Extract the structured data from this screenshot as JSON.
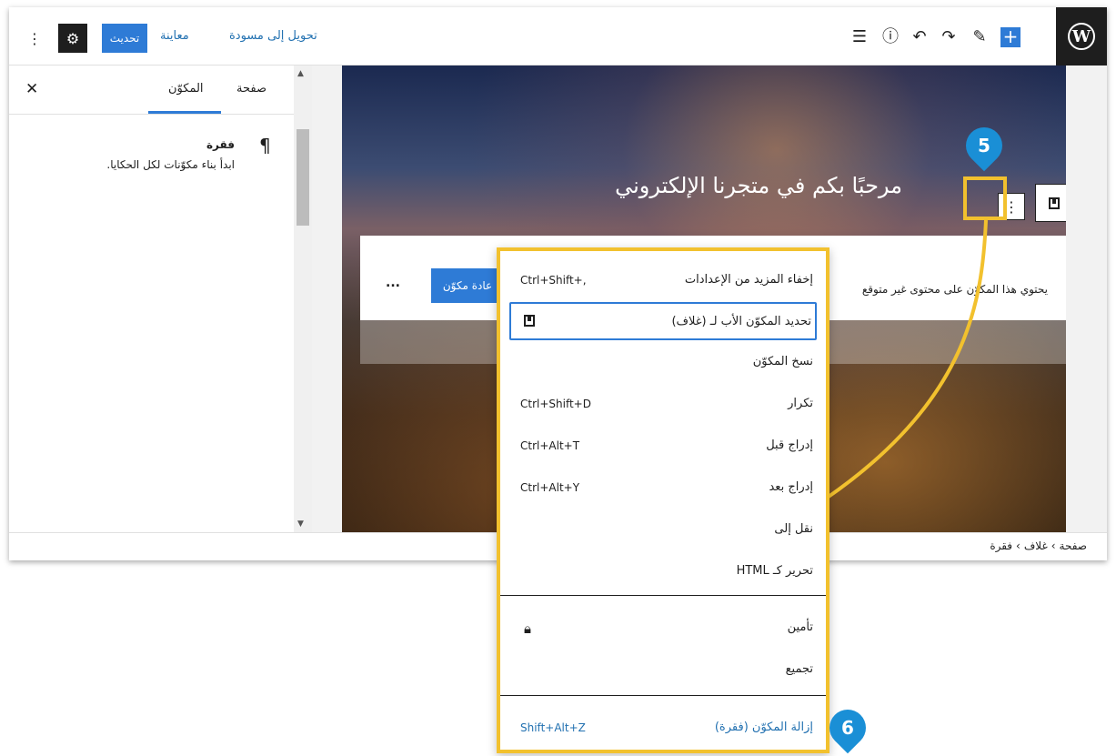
{
  "toolbar": {
    "add_label": "+",
    "convert_draft_link": "تحويل إلى مسودة",
    "preview_link": "معاينة",
    "update_button": "تحديث"
  },
  "sidebar": {
    "tabs": {
      "page": "صفحة",
      "block": "المكوّن"
    },
    "block_title": "فقرة",
    "block_description": "ابدأ بناء مكوّنات لكل الحكايا."
  },
  "canvas": {
    "cover_title": "مرحبًا بكم في متجرنا الإلكتروني",
    "notice_text": "يحتوي هذا المكوّن على محتوى غير متوقع",
    "notice_button": "عادة مكوّن",
    "notice_more": "..."
  },
  "breadcrumb": [
    "صفحة",
    "غلاف",
    "فقرة"
  ],
  "menu": {
    "items": [
      {
        "label": "إخفاء المزيد من الإعدادات",
        "shortcut": "Ctrl+Shift+,"
      },
      {
        "label": "تحديد المكوّن الأب لـ (غلاف)",
        "shortcut": ""
      },
      {
        "label": "نسخ المكوّن",
        "shortcut": ""
      },
      {
        "label": "تكرار",
        "shortcut": "Ctrl+Shift+D"
      },
      {
        "label": "إدراج قبل",
        "shortcut": "Ctrl+Alt+T"
      },
      {
        "label": "إدراج بعد",
        "shortcut": "Ctrl+Alt+Y"
      },
      {
        "label": "نقل إلى",
        "shortcut": ""
      },
      {
        "label": "تحرير كـ HTML",
        "shortcut": ""
      },
      {
        "label": "تأمين",
        "shortcut": ""
      },
      {
        "label": "تجميع",
        "shortcut": ""
      },
      {
        "label": "إزالة المكوّن (فقرة)",
        "shortcut": "Shift+Alt+Z"
      }
    ]
  },
  "annotations": {
    "step5": "5",
    "step6": "6"
  },
  "colors": {
    "accent": "#2e7bd6",
    "highlight": "#f2c12e",
    "callout": "#1a8fd6",
    "dark": "#1e1e1e"
  },
  "icons": [
    "wordpress-logo-icon",
    "plus-icon",
    "list-view-icon",
    "info-icon",
    "undo-icon",
    "redo-icon",
    "pencil-icon",
    "gear-icon",
    "more-vertical-icon",
    "close-icon",
    "pilcrow-icon",
    "bookmark-icon",
    "lock-icon"
  ]
}
